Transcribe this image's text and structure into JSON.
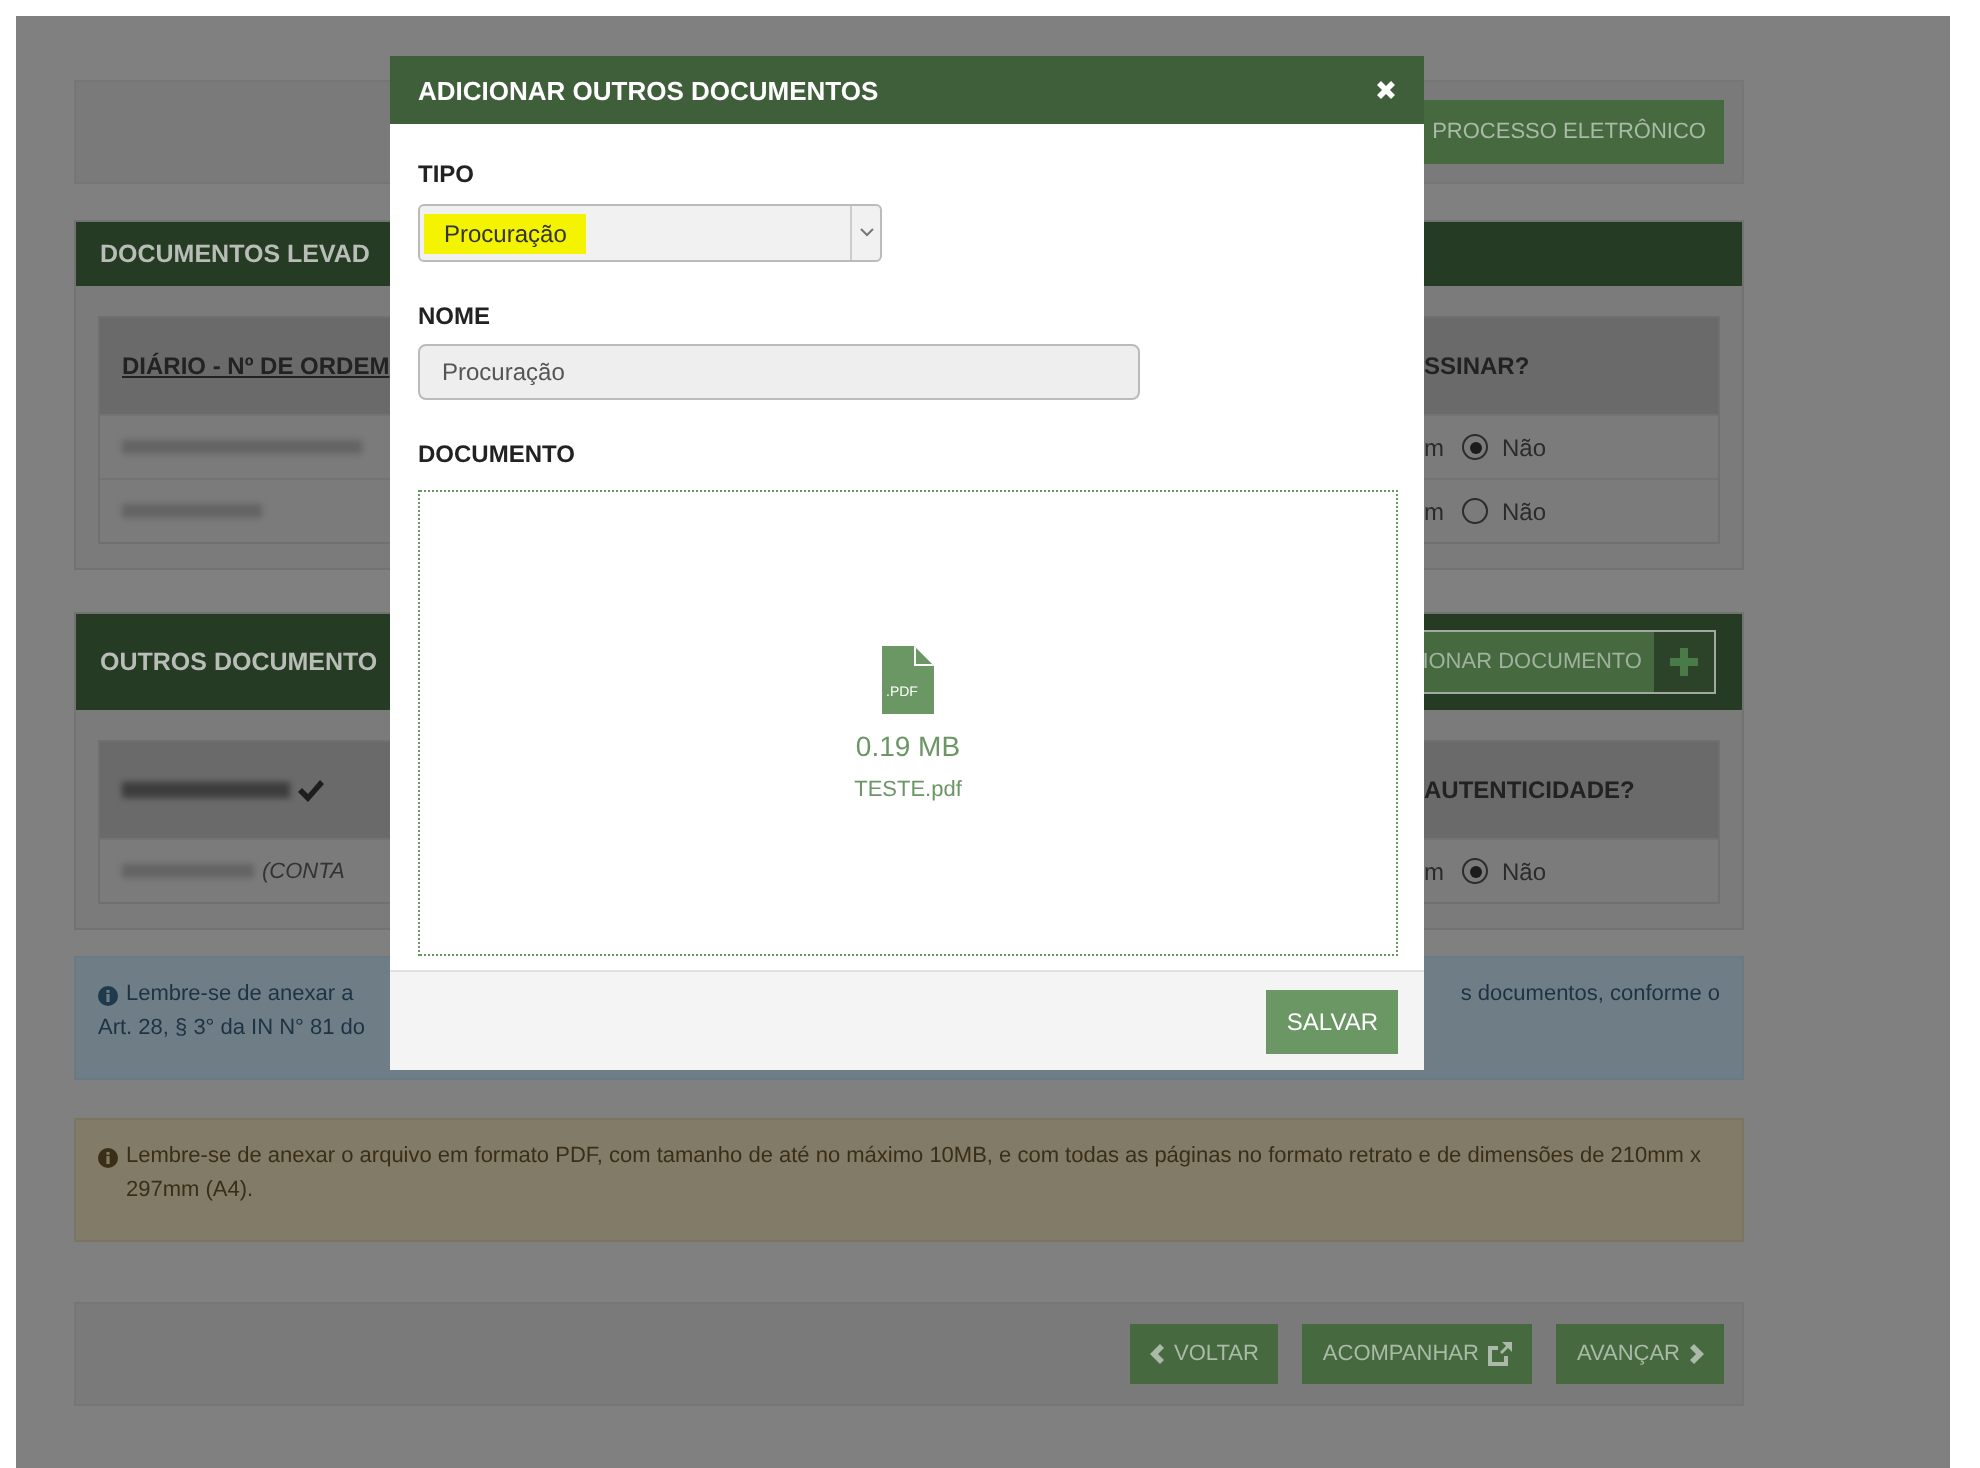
{
  "top_bar": {
    "button": "PROCESSO ELETRÔNICO"
  },
  "panels": [
    {
      "title": "DOCUMENTOS LEVAD",
      "header_left": "DIÁRIO - Nº DE ORDEM",
      "header_right": "SSINAR?",
      "rows": [
        {
          "option_label": "m",
          "radio_label": "Não",
          "selected": true
        },
        {
          "option_label": "m",
          "radio_label": "Não",
          "selected": false
        }
      ]
    },
    {
      "title": "OUTROS DOCUMENTO",
      "action": "IONAR DOCUMENTO",
      "header_check": true,
      "header_right": "AUTENTICIDADE?",
      "rows": [
        {
          "note": "(CONTA",
          "option_label": "m",
          "radio_label": "Não",
          "selected": true
        }
      ]
    }
  ],
  "alerts": [
    {
      "kind": "info",
      "left_lines": [
        "Lembre-se de anexar a",
        "Art. 28, § 3° da IN N° 81 do"
      ],
      "right_lines": [
        "s documentos, conforme o"
      ]
    },
    {
      "kind": "warning",
      "text": "Lembre-se de anexar o arquivo em formato PDF, com tamanho de até no máximo 10MB, e com todas as páginas no formato retrato e de dimensões de 210mm x 297mm (A4)."
    }
  ],
  "footer_buttons": [
    {
      "kind": "back",
      "label": "VOLTAR"
    },
    {
      "kind": "external",
      "label": "ACOMPANHAR"
    },
    {
      "kind": "next",
      "label": "AVANÇAR"
    }
  ],
  "modal": {
    "title": "ADICIONAR OUTROS DOCUMENTOS",
    "tipo": {
      "label": "TIPO",
      "value": "Procuração",
      "highlighted": true
    },
    "nome": {
      "label": "NOME",
      "value": "Procuração"
    },
    "documento": {
      "label": "DOCUMENTO",
      "file_type": ".PDF",
      "size": "0.19 MB",
      "filename": "TESTE.pdf"
    },
    "save": "SALVAR"
  }
}
